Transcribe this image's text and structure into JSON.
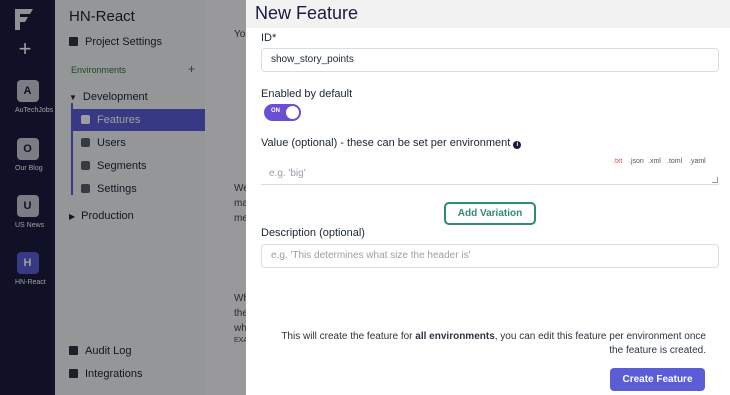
{
  "rail": {
    "add_label": "+",
    "orgs": [
      {
        "initial": "A",
        "name": "AuTechJobs"
      },
      {
        "initial": "O",
        "name": "Our Blog"
      },
      {
        "initial": "U",
        "name": "US News"
      },
      {
        "initial": "H",
        "name": "HN-React"
      }
    ]
  },
  "sidebar": {
    "project_title": "HN-React",
    "project_settings": "Project Settings",
    "environments_label": "Environments",
    "environments_add": "+",
    "development": "Development",
    "dev_items": [
      "Features",
      "Users",
      "Segments",
      "Settings"
    ],
    "production": "Production",
    "audit_log": "Audit Log",
    "integrations": "Integrations"
  },
  "background_snippets": [
    "Yo",
    "We",
    "ma",
    "me",
    "Wh",
    "the",
    "wh",
    "EXA"
  ],
  "modal": {
    "title": "New Feature",
    "id_label": "ID*",
    "id_value": "show_story_points",
    "enabled_label": "Enabled by default",
    "toggle_text": "ON",
    "value_label": "Value (optional) - these can be set per environment",
    "formats": [
      ".txt",
      ".json",
      ".xml",
      ".toml",
      ".yaml"
    ],
    "value_placeholder": "e.g. 'big'",
    "add_variation": "Add Variation",
    "description_label": "Description (optional)",
    "description_placeholder": "e.g. 'This determines what size the header is'",
    "footnote_pre": "This will create the feature for ",
    "footnote_bold": "all environments",
    "footnote_post": ", you can edit this feature per environment once the feature is created.",
    "create_button": "Create Feature"
  }
}
